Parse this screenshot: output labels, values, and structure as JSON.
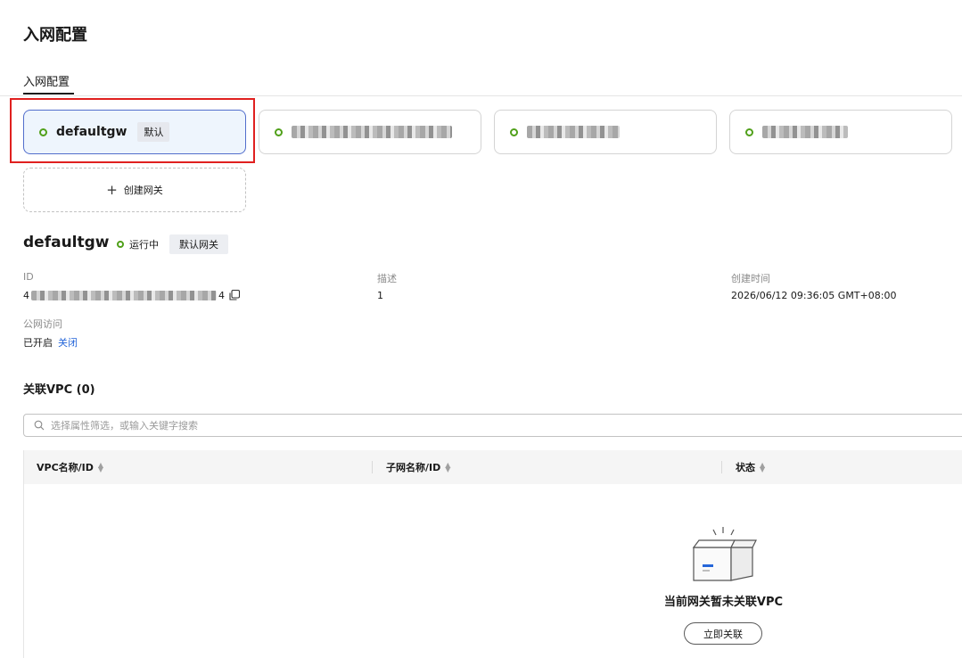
{
  "page": {
    "title": "入网配置"
  },
  "tabs": [
    {
      "label": "入网配置",
      "active": true
    }
  ],
  "gateways": [
    {
      "name": "defaultgw",
      "tag": "默认",
      "selected": true,
      "status_color": "#50a01a"
    },
    {
      "name": "",
      "redacted": true,
      "selected": false,
      "status_color": "#50a01a"
    },
    {
      "name": "",
      "redacted": true,
      "selected": false,
      "status_color": "#50a01a"
    },
    {
      "name": "",
      "redacted": true,
      "selected": false,
      "status_color": "#50a01a"
    }
  ],
  "create_gateway_label": "创建网关",
  "detail": {
    "name": "defaultgw",
    "status": "运行中",
    "default_tag": "默认网关",
    "fields": {
      "id_label": "ID",
      "id_value_prefix": "4",
      "id_value_suffix": "4",
      "desc_label": "描述",
      "desc_value": "1",
      "created_label": "创建时间",
      "created_value": "2026/06/12 09:36:05 GMT+08:00",
      "public_label": "公网访问",
      "public_value": "已开启",
      "public_action": "关闭"
    }
  },
  "vpc_section": {
    "title": "关联VPC (0)",
    "search_placeholder": "选择属性筛选，或输入关键字搜索",
    "columns": [
      "VPC名称/ID",
      "子网名称/ID",
      "状态"
    ],
    "rows": [],
    "empty_text": "当前网关暂未关联VPC",
    "empty_button": "立即关联"
  },
  "colors": {
    "accent": "#2566d9",
    "status_running": "#50a01a",
    "highlight": "#e0201f",
    "selected_bg": "#eef5fd",
    "selected_border": "#526ecc"
  }
}
